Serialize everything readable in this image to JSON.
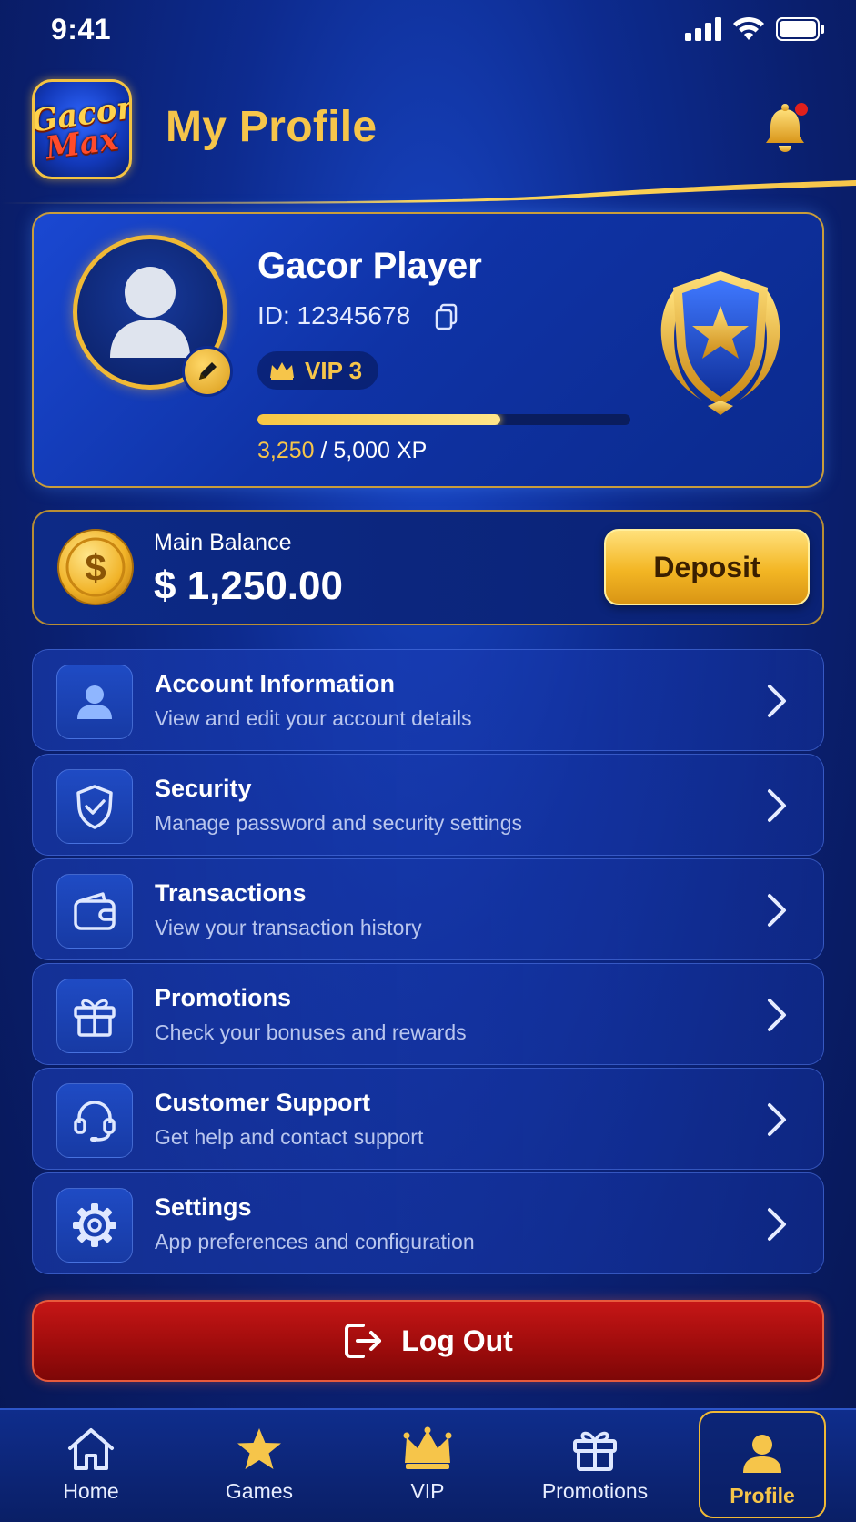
{
  "status_bar": {
    "time": "9:41"
  },
  "header": {
    "logo_line1": "Gacor",
    "logo_line2": "Max",
    "title": "My Profile",
    "notification_dot_color": "#e0201c"
  },
  "profile": {
    "name": "Gacor Player",
    "id_text": "ID: 12345678",
    "vip_label": "VIP 3",
    "xp_current": "3,250",
    "xp_rest": " / 5,000 XP",
    "xp_progress": 0.65
  },
  "balance": {
    "label": "Main Balance",
    "value": "$ 1,250.00",
    "deposit_label": "Deposit"
  },
  "menu": [
    {
      "title": "Account Information",
      "subtitle": "View and edit your account details",
      "icon": "user-icon"
    },
    {
      "title": "Security",
      "subtitle": "Manage password and security settings",
      "icon": "shield-check-icon"
    },
    {
      "title": "Transactions",
      "subtitle": "View your transaction history",
      "icon": "wallet-icon"
    },
    {
      "title": "Promotions",
      "subtitle": "Check your bonuses and rewards",
      "icon": "gift-icon"
    },
    {
      "title": "Customer Support",
      "subtitle": "Get help and contact support",
      "icon": "headset-icon"
    },
    {
      "title": "Settings",
      "subtitle": "App preferences and configuration",
      "icon": "gear-icon"
    }
  ],
  "logout_label": "Log Out",
  "bottom_nav": [
    {
      "label": "Home",
      "icon": "home-icon"
    },
    {
      "label": "Games",
      "icon": "star-icon"
    },
    {
      "label": "VIP",
      "icon": "crown-icon"
    },
    {
      "label": "Promotions",
      "icon": "gift-icon"
    },
    {
      "label": "Profile",
      "icon": "user-icon",
      "active": true
    }
  ],
  "colors": {
    "gold": "#f6c54a",
    "background": "#0d2b8f",
    "logout_red": "#a00c0c"
  }
}
